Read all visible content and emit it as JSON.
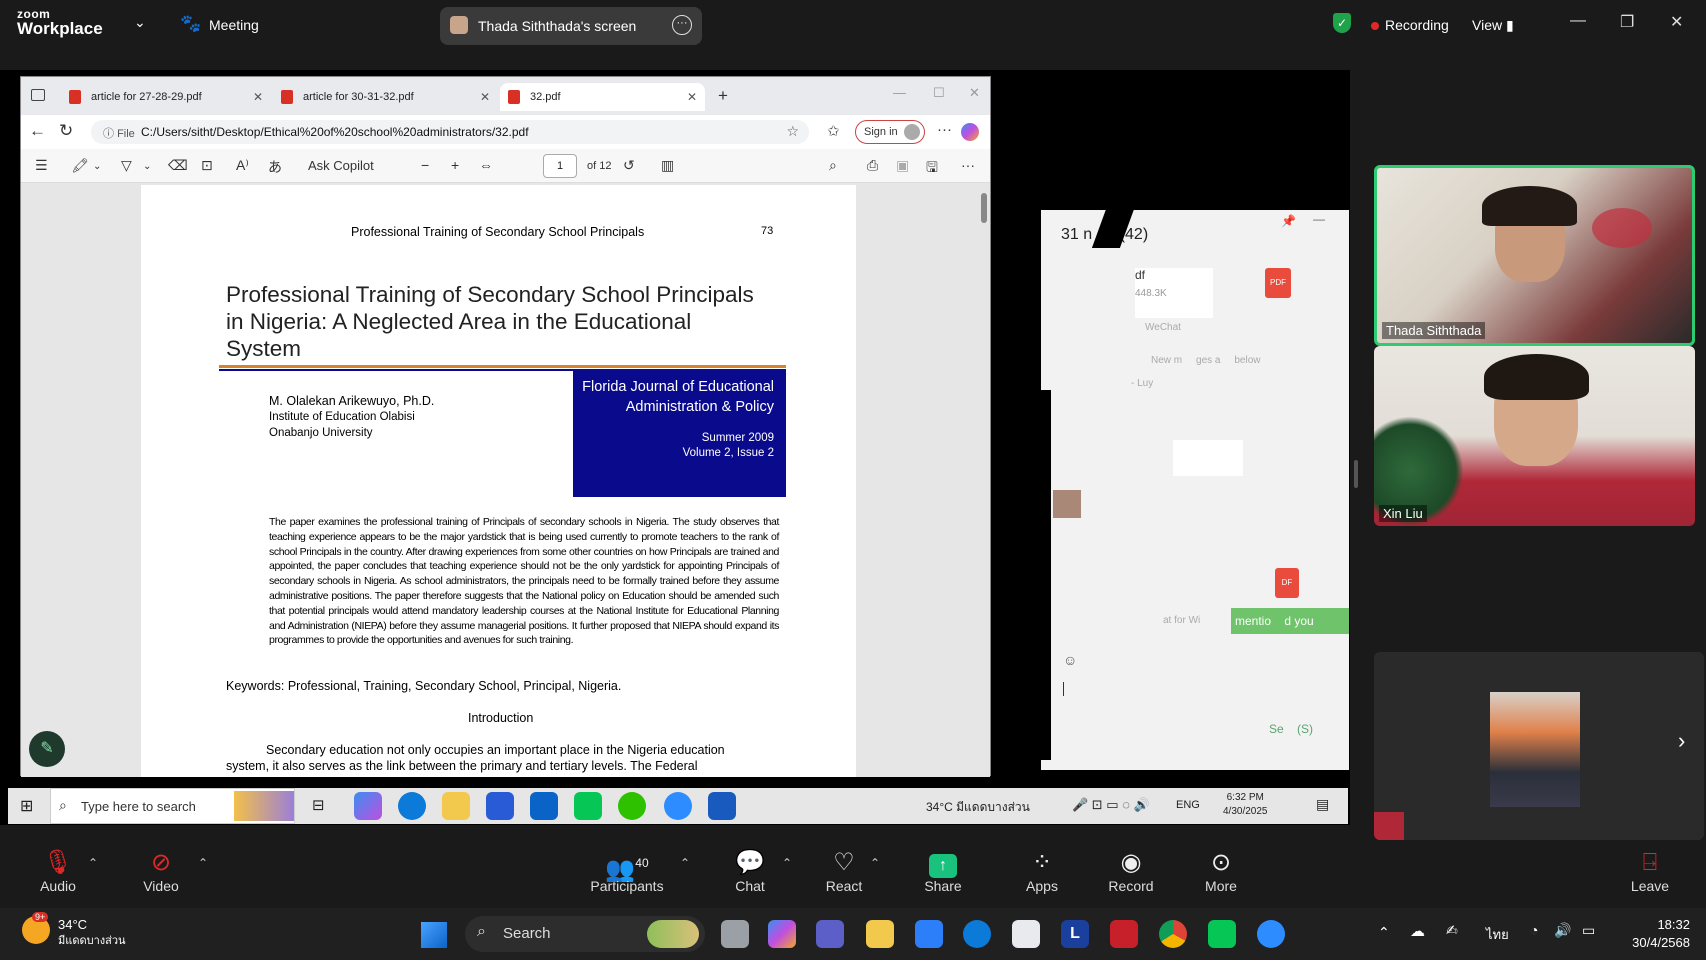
{
  "zoom": {
    "logo_top": "zoom",
    "logo_bottom": "Workplace",
    "meeting_label": "Meeting",
    "share_label": "Thada Siththada's screen",
    "recording_label": "Recording",
    "view_label": "View"
  },
  "edge": {
    "tabs": [
      {
        "label": "article for 27-28-29.pdf"
      },
      {
        "label": "article for 30-31-32.pdf"
      },
      {
        "label": "32.pdf"
      }
    ],
    "url_prefix": "File",
    "url": "C:/Users/sitht/Desktop/Ethical%20of%20school%20administrators/32.pdf",
    "signin_label": "Sign in",
    "ask_copilot": "Ask Copilot",
    "page_number": "1",
    "page_total": "of 12"
  },
  "pdf": {
    "running_header": "Professional Training of Secondary School Principals",
    "page_num": "73",
    "title_line1": "Professional Training of Secondary School Principals",
    "title_line2": "in Nigeria: A Neglected Area in the Educational",
    "title_line3": "System",
    "author_name": "M. Olalekan Arikewuyo, Ph.D.",
    "author_inst": "Institute of Education Olabisi",
    "author_univ": "Onabanjo University",
    "journal_line1": "Florida Journal of Educational",
    "journal_line2": "Administration & Policy",
    "journal_issue1": "Summer 2009",
    "journal_issue2": "Volume 2, Issue 2",
    "abstract": "The paper examines the professional training of Principals of secondary schools in Nigeria. The study observes that teaching experience appears to be the major yardstick that is being used currently to promote teachers to the rank of school Principals in the country. After drawing experiences from some other countries on how Principals are trained and appointed, the paper concludes that teaching experience should not be the only yardstick for appointing Principals of secondary schools in Nigeria. As school administrators, the principals need to be formally trained before they assume administrative positions. The paper therefore suggests that the National policy on Education should be amended such that potential principals would attend mandatory leadership courses at the National Institute for Educational Planning and Administration (NIEPA) before they assume managerial positions. It further proposed that NIEPA should expand its programmes to provide the opportunities and avenues for such training.",
    "keywords": "Keywords: Professional, Training, Secondary School, Principal, Nigeria.",
    "section_heading": "Introduction",
    "body_line1": "Secondary education not only occupies an important place in the Nigeria education",
    "body_line2": "system, it also serves as the link between the primary and tertiary levels. The Federal"
  },
  "wechat": {
    "title": "31 n     r(42)",
    "file_ext": "df",
    "file_size": "448.3K",
    "source": "WeChat",
    "new_msgs": "New m     ges a     below",
    "user": "- Luy",
    "mention": "mentio    d you",
    "at_for": "at for Wi",
    "send": "Se    (S)"
  },
  "win_taskbar": {
    "search": "Type here to search",
    "weather": "34°C  มีแดดบางส่วน",
    "lang": "ENG",
    "time": "6:32 PM",
    "date": "4/30/2025"
  },
  "participants": [
    {
      "name": "Thada Siththada"
    },
    {
      "name": "Xin Liu"
    }
  ],
  "toolbar": {
    "audio": "Audio",
    "video": "Video",
    "participants": "Participants",
    "participants_count": "40",
    "chat": "Chat",
    "react": "React",
    "share": "Share",
    "apps": "Apps",
    "record": "Record",
    "more": "More",
    "leave": "Leave"
  },
  "w11": {
    "weather_temp": "34°C",
    "weather_desc": "มีแดดบางส่วน",
    "search": "Search",
    "lang": "ไทย",
    "time": "18:32",
    "date": "30/4/2568",
    "badge": "9+"
  },
  "colors": {
    "journal_blue": "#0a0a8c",
    "title_rule": "#d9822b",
    "active_speaker": "#2ecc71",
    "share_green": "#19c37d",
    "leave_red": "#e02828"
  }
}
